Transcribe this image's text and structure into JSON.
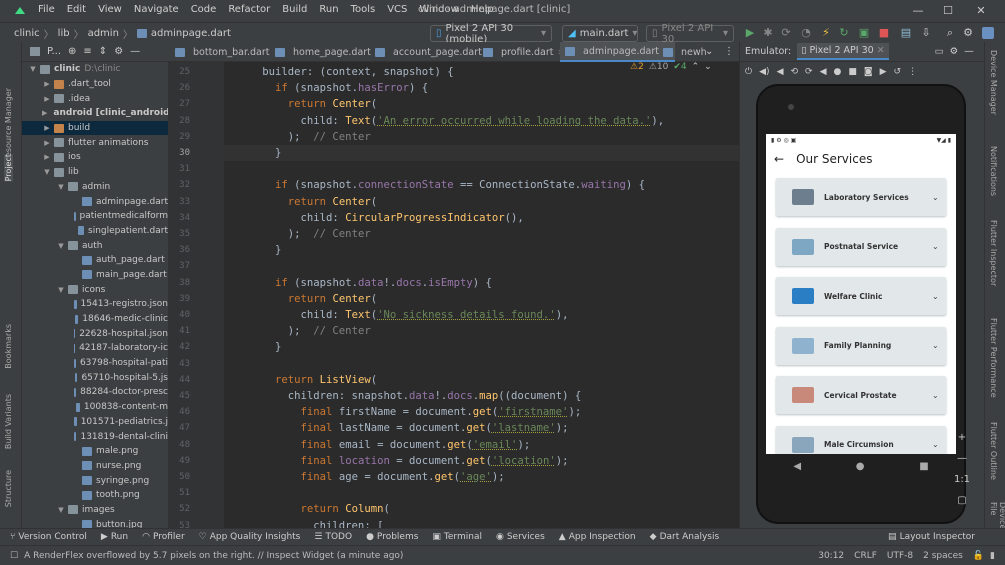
{
  "window": {
    "title": "clinic - adminpage.dart [clinic]",
    "minimize": "—",
    "maximize": "☐",
    "close": "✕"
  },
  "menu": [
    "File",
    "Edit",
    "View",
    "Navigate",
    "Code",
    "Refactor",
    "Build",
    "Run",
    "Tools",
    "VCS",
    "Window",
    "Help"
  ],
  "breadcrumb": [
    "clinic",
    "lib",
    "admin",
    "adminpage.dart"
  ],
  "device_selector": "Pixel 2 API 30 (mobile)",
  "run_config": "main.dart",
  "avd_selector": "Pixel 2 API 30",
  "project_panel": {
    "title": "P...",
    "items": [
      {
        "label": "clinic",
        "suffix": "D:\\clinic",
        "indent": 0,
        "type": "folder",
        "open": true,
        "bold": true
      },
      {
        "label": ".dart_tool",
        "indent": 1,
        "type": "folder-orange",
        "open": false
      },
      {
        "label": ".idea",
        "indent": 1,
        "type": "folder",
        "open": false
      },
      {
        "label": "android [clinic_android]",
        "indent": 1,
        "type": "folder",
        "open": false,
        "bold": true
      },
      {
        "label": "build",
        "indent": 1,
        "type": "folder-orange",
        "open": false,
        "selected": true
      },
      {
        "label": "flutter animations",
        "indent": 1,
        "type": "folder",
        "open": false
      },
      {
        "label": "ios",
        "indent": 1,
        "type": "folder",
        "open": false
      },
      {
        "label": "lib",
        "indent": 1,
        "type": "folder",
        "open": true
      },
      {
        "label": "admin",
        "indent": 2,
        "type": "folder",
        "open": true
      },
      {
        "label": "adminpage.dart",
        "indent": 3,
        "type": "file"
      },
      {
        "label": "patientmedicalform",
        "indent": 3,
        "type": "file"
      },
      {
        "label": "singlepatient.dart",
        "indent": 3,
        "type": "file"
      },
      {
        "label": "auth",
        "indent": 2,
        "type": "folder",
        "open": true
      },
      {
        "label": "auth_page.dart",
        "indent": 3,
        "type": "file"
      },
      {
        "label": "main_page.dart",
        "indent": 3,
        "type": "file"
      },
      {
        "label": "icons",
        "indent": 2,
        "type": "folder",
        "open": true
      },
      {
        "label": "15413-registro.json",
        "indent": 3,
        "type": "file"
      },
      {
        "label": "18646-medic-clinic",
        "indent": 3,
        "type": "file"
      },
      {
        "label": "22628-hospital.json",
        "indent": 3,
        "type": "file"
      },
      {
        "label": "42187-laboratory-ic",
        "indent": 3,
        "type": "file"
      },
      {
        "label": "63798-hospital-pati",
        "indent": 3,
        "type": "file"
      },
      {
        "label": "65710-hospital-5.js",
        "indent": 3,
        "type": "file"
      },
      {
        "label": "88284-doctor-presc",
        "indent": 3,
        "type": "file"
      },
      {
        "label": "100838-content-m",
        "indent": 3,
        "type": "file"
      },
      {
        "label": "101571-pediatrics.j",
        "indent": 3,
        "type": "file"
      },
      {
        "label": "131819-dental-clini",
        "indent": 3,
        "type": "file"
      },
      {
        "label": "male.png",
        "indent": 3,
        "type": "file"
      },
      {
        "label": "nurse.png",
        "indent": 3,
        "type": "file"
      },
      {
        "label": "syringe.png",
        "indent": 3,
        "type": "file"
      },
      {
        "label": "tooth.png",
        "indent": 3,
        "type": "file"
      },
      {
        "label": "images",
        "indent": 2,
        "type": "folder",
        "open": true
      },
      {
        "label": "button.jpg",
        "indent": 3,
        "type": "file"
      }
    ]
  },
  "editor_tabs": [
    "bottom_bar.dart",
    "home_page.dart",
    "account_page.dart",
    "profile.dart",
    "adminpage.dart",
    "newh"
  ],
  "active_tab": "adminpage.dart",
  "inspections": {
    "warnings": "2",
    "weak_warnings": "10",
    "ok": "4"
  },
  "code_lines": [
    {
      "n": "25",
      "t": [
        [
          "pl",
          "      builder: (context, snapshot) {"
        ]
      ]
    },
    {
      "n": "26",
      "t": [
        [
          "kw",
          "        if "
        ],
        [
          "pl",
          "(snapshot."
        ],
        [
          "fld",
          "hasError"
        ],
        [
          "pl",
          ") {"
        ]
      ]
    },
    {
      "n": "27",
      "t": [
        [
          "kw",
          "          return "
        ],
        [
          "fn",
          "Center"
        ],
        [
          "pl",
          "("
        ]
      ]
    },
    {
      "n": "28",
      "t": [
        [
          "pl",
          "            child: "
        ],
        [
          "fn",
          "Text"
        ],
        [
          "pl",
          "("
        ],
        [
          "str",
          "'An error occurred while loading the data.'"
        ],
        [
          "pl",
          "),"
        ]
      ]
    },
    {
      "n": "29",
      "t": [
        [
          "pl",
          "          );  "
        ],
        [
          "cm",
          "// Center"
        ]
      ]
    },
    {
      "n": "30",
      "t": [
        [
          "pl",
          "        }"
        ]
      ]
    },
    {
      "n": "31",
      "t": [
        [
          "pl",
          ""
        ]
      ]
    },
    {
      "n": "32",
      "t": [
        [
          "kw",
          "        if "
        ],
        [
          "pl",
          "(snapshot."
        ],
        [
          "fld",
          "connectionState"
        ],
        [
          "pl",
          " == ConnectionState."
        ],
        [
          "fld",
          "waiting"
        ],
        [
          "pl",
          ") {"
        ]
      ]
    },
    {
      "n": "33",
      "t": [
        [
          "kw",
          "          return "
        ],
        [
          "fn",
          "Center"
        ],
        [
          "pl",
          "("
        ]
      ]
    },
    {
      "n": "34",
      "t": [
        [
          "pl",
          "            child: "
        ],
        [
          "fn",
          "CircularProgressIndicator"
        ],
        [
          "pl",
          "(),"
        ]
      ]
    },
    {
      "n": "35",
      "t": [
        [
          "pl",
          "          );  "
        ],
        [
          "cm",
          "// Center"
        ]
      ]
    },
    {
      "n": "36",
      "t": [
        [
          "pl",
          "        }"
        ]
      ]
    },
    {
      "n": "37",
      "t": [
        [
          "pl",
          ""
        ]
      ]
    },
    {
      "n": "38",
      "t": [
        [
          "kw",
          "        if "
        ],
        [
          "pl",
          "(snapshot."
        ],
        [
          "fld",
          "data"
        ],
        [
          "pl",
          "!."
        ],
        [
          "fld",
          "docs"
        ],
        [
          "pl",
          "."
        ],
        [
          "fld",
          "isEmpty"
        ],
        [
          "pl",
          ") {"
        ]
      ]
    },
    {
      "n": "39",
      "t": [
        [
          "kw",
          "          return "
        ],
        [
          "fn",
          "Center"
        ],
        [
          "pl",
          "("
        ]
      ]
    },
    {
      "n": "40",
      "t": [
        [
          "pl",
          "            child: "
        ],
        [
          "fn",
          "Text"
        ],
        [
          "pl",
          "("
        ],
        [
          "str",
          "'No sickness details found.'"
        ],
        [
          "pl",
          "),"
        ]
      ]
    },
    {
      "n": "41",
      "t": [
        [
          "pl",
          "          );  "
        ],
        [
          "cm",
          "// Center"
        ]
      ]
    },
    {
      "n": "42",
      "t": [
        [
          "pl",
          "        }"
        ]
      ]
    },
    {
      "n": "43",
      "t": [
        [
          "pl",
          ""
        ]
      ]
    },
    {
      "n": "44",
      "t": [
        [
          "kw",
          "        return "
        ],
        [
          "fn",
          "ListView"
        ],
        [
          "pl",
          "("
        ]
      ]
    },
    {
      "n": "45",
      "t": [
        [
          "pl",
          "          children: snapshot."
        ],
        [
          "fld",
          "data"
        ],
        [
          "pl",
          "!."
        ],
        [
          "fld",
          "docs"
        ],
        [
          "pl",
          "."
        ],
        [
          "fn",
          "map"
        ],
        [
          "pl",
          "((document) {"
        ]
      ]
    },
    {
      "n": "46",
      "t": [
        [
          "kw",
          "            final "
        ],
        [
          "pl",
          "firstName = document."
        ],
        [
          "fn",
          "get"
        ],
        [
          "pl",
          "("
        ],
        [
          "str",
          "'firstname'"
        ],
        [
          "pl",
          ");"
        ]
      ]
    },
    {
      "n": "47",
      "t": [
        [
          "kw",
          "            final "
        ],
        [
          "pl",
          "lastName = document."
        ],
        [
          "fn",
          "get"
        ],
        [
          "pl",
          "("
        ],
        [
          "str",
          "'lastname'"
        ],
        [
          "pl",
          ");"
        ]
      ]
    },
    {
      "n": "48",
      "t": [
        [
          "kw",
          "            final "
        ],
        [
          "pl",
          "email = document."
        ],
        [
          "fn",
          "get"
        ],
        [
          "pl",
          "("
        ],
        [
          "str",
          "'email'"
        ],
        [
          "pl",
          ");"
        ]
      ]
    },
    {
      "n": "49",
      "t": [
        [
          "kw",
          "            final "
        ],
        [
          "fld",
          "location"
        ],
        [
          "pl",
          " = document."
        ],
        [
          "fn",
          "get"
        ],
        [
          "pl",
          "("
        ],
        [
          "str",
          "'location'"
        ],
        [
          "pl",
          ");"
        ]
      ]
    },
    {
      "n": "50",
      "t": [
        [
          "kw",
          "            final "
        ],
        [
          "pl",
          "age = document."
        ],
        [
          "fn",
          "get"
        ],
        [
          "pl",
          "("
        ],
        [
          "str",
          "'age'"
        ],
        [
          "pl",
          ");"
        ]
      ]
    },
    {
      "n": "51",
      "t": [
        [
          "pl",
          ""
        ]
      ]
    },
    {
      "n": "52",
      "t": [
        [
          "kw",
          "            return "
        ],
        [
          "fn",
          "Column"
        ],
        [
          "pl",
          "("
        ]
      ]
    },
    {
      "n": "53",
      "t": [
        [
          "pl",
          "              children: ["
        ]
      ]
    }
  ],
  "emulator": {
    "label": "Emulator:",
    "tab": "Pixel 2 API 30",
    "app_title": "Our Services",
    "services": [
      {
        "label": "Laboratory Services",
        "color": "#6d7f8e"
      },
      {
        "label": "Postnatal Service",
        "color": "#7ea7c4"
      },
      {
        "label": "Welfare Clinic",
        "color": "#2a7fc4"
      },
      {
        "label": "Family Planning",
        "color": "#8fb2cf"
      },
      {
        "label": "Cervical Prostate",
        "color": "#c9897a"
      },
      {
        "label": "Male Circumsion",
        "color": "#8aa6bd"
      }
    ],
    "zoom_ratio": "1:1"
  },
  "left_strip_labels": [
    "Resource Manager",
    "Project",
    "Bookmarks",
    "Build Variants",
    "Structure"
  ],
  "right_strip_labels": [
    "Device Manager",
    "Notifications",
    "Flutter Inspector",
    "Flutter Performance",
    "Flutter Outline",
    "Device File"
  ],
  "bottom_tools": [
    "Version Control",
    "Run",
    "Profiler",
    "App Quality Insights",
    "TODO",
    "Problems",
    "Terminal",
    "Services",
    "App Inspection",
    "Dart Analysis"
  ],
  "layout_inspector": "Layout Inspector",
  "status": {
    "message": "A RenderFlex overflowed by 5.7 pixels on the right. // Inspect Widget (a minute ago)",
    "position": "30:12",
    "line_sep": "CRLF",
    "encoding": "UTF-8",
    "indent": "2 spaces"
  }
}
